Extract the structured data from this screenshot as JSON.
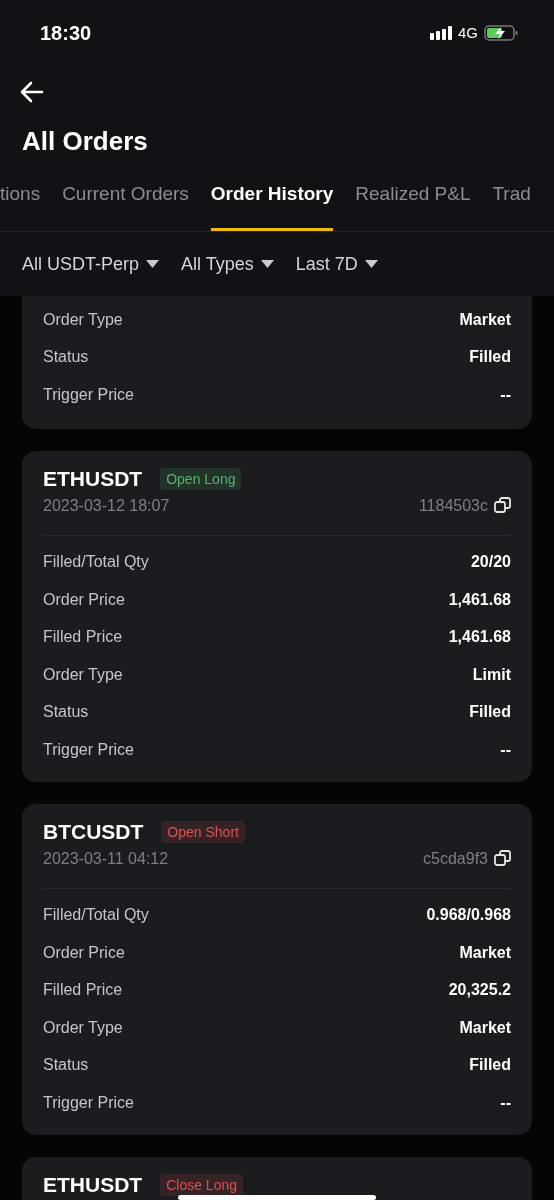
{
  "status_bar": {
    "time": "18:30",
    "network": "4G"
  },
  "header": {
    "title": "All Orders"
  },
  "tabs": [
    {
      "label": "tions",
      "selected": false
    },
    {
      "label": "Current Orders",
      "selected": false
    },
    {
      "label": "Order History",
      "selected": true
    },
    {
      "label": "Realized P&L",
      "selected": false
    },
    {
      "label": "Trad",
      "selected": false
    }
  ],
  "filters": [
    {
      "label": "All USDT-Perp"
    },
    {
      "label": "All Types"
    },
    {
      "label": "Last 7D"
    }
  ],
  "orders": [
    {
      "rows": [
        {
          "label": "Order Type",
          "value": "Market"
        },
        {
          "label": "Status",
          "value": "Filled"
        },
        {
          "label": "Trigger Price",
          "value": "--"
        }
      ]
    },
    {
      "symbol": "ETHUSDT",
      "tag": "Open Long",
      "color": "#58b26c",
      "time": "2023-03-12 18:07",
      "id": "1184503c",
      "rows": [
        {
          "label": "Filled/Total Qty",
          "value": "20/20"
        },
        {
          "label": "Order Price",
          "value": "1,461.68"
        },
        {
          "label": "Filled Price",
          "value": "1,461.68"
        },
        {
          "label": "Order Type",
          "value": "Limit"
        },
        {
          "label": "Status",
          "value": "Filled"
        },
        {
          "label": "Trigger Price",
          "value": "--"
        }
      ]
    },
    {
      "symbol": "BTCUSDT",
      "tag": "Open Short",
      "color": "#d9534f",
      "time": "2023-03-11 04:12",
      "id": "c5cda9f3",
      "rows": [
        {
          "label": "Filled/Total Qty",
          "value": "0.968/0.968"
        },
        {
          "label": "Order Price",
          "value": "Market"
        },
        {
          "label": "Filled Price",
          "value": "20,325.2"
        },
        {
          "label": "Order Type",
          "value": "Market"
        },
        {
          "label": "Status",
          "value": "Filled"
        },
        {
          "label": "Trigger Price",
          "value": "--"
        }
      ]
    },
    {
      "symbol": "ETHUSDT",
      "tag": "Close Long",
      "color": "#d9534f"
    }
  ]
}
